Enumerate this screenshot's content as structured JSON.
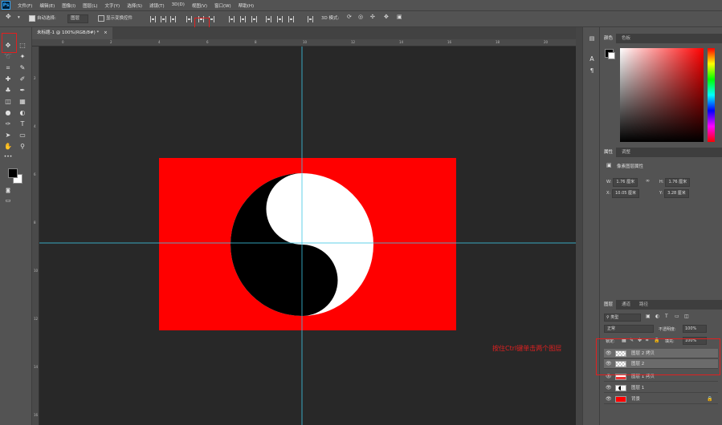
{
  "menubar": {
    "logo": "Ps",
    "items": [
      "文件(F)",
      "编辑(E)",
      "图像(I)",
      "图层(L)",
      "文字(Y)",
      "选择(S)",
      "滤镜(T)",
      "3D(D)",
      "视图(V)",
      "窗口(W)",
      "帮助(H)"
    ]
  },
  "options": {
    "auto_select_label": "自动选择:",
    "auto_select_value": "图层",
    "show_transform_label": "显示变换控件",
    "mode_3d_label": "3D 模式:"
  },
  "document": {
    "tab_label": "未标题-1 @ 100%(RGB/8#) *",
    "close": "×"
  },
  "ruler_ticks": [
    "0",
    "2",
    "4",
    "6",
    "8",
    "10",
    "12",
    "14",
    "16",
    "18",
    "20",
    "22"
  ],
  "ruler_v_ticks": [
    "2",
    "4",
    "6",
    "8",
    "10",
    "12",
    "14",
    "16"
  ],
  "panels": {
    "color_tabs": [
      "颜色",
      "色板"
    ],
    "properties_tabs": [
      "属性",
      "调整"
    ],
    "properties_title": "像素图层属性",
    "w_label": "W:",
    "w_value": "1.76 厘米",
    "h_label": "H:",
    "h_value": "1.76 厘米",
    "x_label": "X:",
    "x_value": "10.05 厘米",
    "y_label": "Y:",
    "y_value": "3.28 厘米",
    "layers_tabs": [
      "图层",
      "通道",
      "路径"
    ],
    "filter_kind": "类型",
    "blend_mode": "正常",
    "opacity_label": "不透明度:",
    "opacity_value": "100%",
    "lock_label": "锁定:",
    "fill_label": "填充:",
    "fill_value": "100%",
    "layers": [
      {
        "name": "图层 2 拷贝",
        "selected": true,
        "thumb": "checker"
      },
      {
        "name": "图层 2",
        "selected": true,
        "thumb": "checker"
      },
      {
        "name": "图层 1 拷贝",
        "selected": false,
        "thumb": "half"
      },
      {
        "name": "图层 1",
        "selected": false,
        "thumb": "yinyang"
      },
      {
        "name": "背景",
        "selected": false,
        "thumb": "red"
      }
    ]
  },
  "annotation": "按住Ctrl键单击两个图层",
  "colors": {
    "canvas_red": "#ff0000",
    "guide": "#3cc8e6",
    "highlight": "#e02020"
  }
}
